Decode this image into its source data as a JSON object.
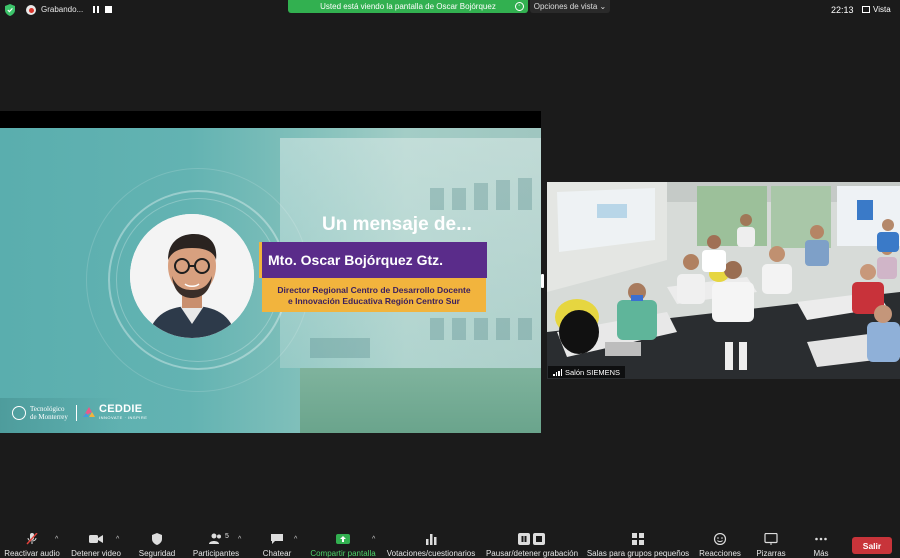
{
  "topbar": {
    "recording_label": "Grabando...",
    "share_banner": "Usted está viendo la pantalla de Oscar Bojórquez",
    "view_options": "Opciones de vista",
    "clock": "22:13",
    "view_label": "Vista"
  },
  "slide": {
    "title": "Un mensaje de...",
    "name": "Mto. Oscar Bojórquez Gtz.",
    "role_line1": "Director Regional Centro de Desarrollo Docente",
    "role_line2": "e Innovación Educativa Región Centro Sur",
    "logo_tec_line1": "Tecnológico",
    "logo_tec_line2": "de Monterrey",
    "logo_ceddie": "CEDDIE",
    "logo_ceddie_sub": "INNOVATE · INSPIRE"
  },
  "video": {
    "participant_label": "Salón SIEMENS"
  },
  "toolbar": {
    "items": [
      {
        "label": "Reactivar audio"
      },
      {
        "label": "Detener video"
      },
      {
        "label": "Seguridad"
      },
      {
        "label": "Participantes",
        "count": "5"
      },
      {
        "label": "Chatear"
      },
      {
        "label": "Compartir pantalla"
      },
      {
        "label": "Votaciones/cuestionarios"
      },
      {
        "label": "Pausar/detener grabación"
      },
      {
        "label": "Salas para grupos pequeños"
      },
      {
        "label": "Reacciones"
      },
      {
        "label": "Pizarras"
      },
      {
        "label": "Más"
      }
    ],
    "leave_label": "Salir"
  },
  "colors": {
    "share_green": "#32b050",
    "name_purple": "#5a2c8a",
    "role_gold": "#f2b43d",
    "leave_red": "#c8343a"
  }
}
